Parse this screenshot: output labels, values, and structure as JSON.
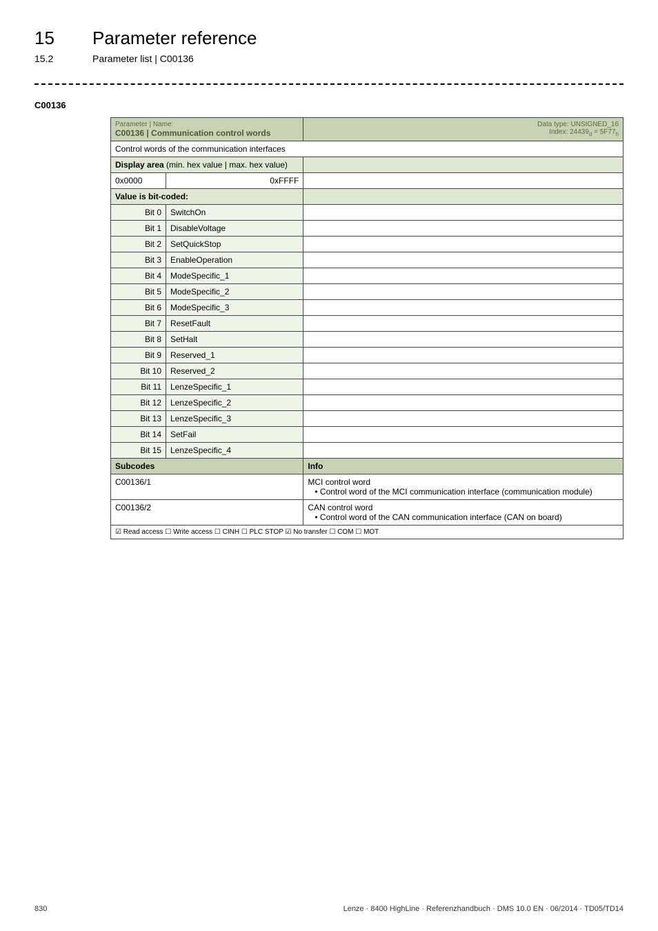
{
  "header": {
    "chapter_number": "15",
    "chapter_title": "Parameter reference",
    "section_number": "15.2",
    "section_title": "Parameter list | C00136"
  },
  "param_code_label": "C00136",
  "table": {
    "title_left_small": "Parameter | Name:",
    "title_left_bold": "C00136 | Communication control words",
    "title_right_line1": "Data type: UNSIGNED_16",
    "title_right_line2": "Index: 24439",
    "title_right_line2_sub1": "d",
    "title_right_line2_eq": " = 5F77",
    "title_right_line2_sub2": "h",
    "desc": "Control words of the communication interfaces",
    "display_area_label": "Display area",
    "display_area_paren": " (min. hex value | max. hex value)",
    "hex_min": "0x0000",
    "hex_max": "0xFFFF",
    "value_coded_label": "Value is bit-coded:",
    "bits": [
      {
        "label": "Bit 0",
        "name": "SwitchOn"
      },
      {
        "label": "Bit 1",
        "name": "DisableVoltage"
      },
      {
        "label": "Bit 2",
        "name": "SetQuickStop"
      },
      {
        "label": "Bit 3",
        "name": "EnableOperation"
      },
      {
        "label": "Bit 4",
        "name": "ModeSpecific_1"
      },
      {
        "label": "Bit 5",
        "name": "ModeSpecific_2"
      },
      {
        "label": "Bit 6",
        "name": "ModeSpecific_3"
      },
      {
        "label": "Bit 7",
        "name": "ResetFault"
      },
      {
        "label": "Bit 8",
        "name": "SetHalt"
      },
      {
        "label": "Bit 9",
        "name": "Reserved_1"
      },
      {
        "label": "Bit 10",
        "name": "Reserved_2"
      },
      {
        "label": "Bit 11",
        "name": "LenzeSpecific_1"
      },
      {
        "label": "Bit 12",
        "name": "LenzeSpecific_2"
      },
      {
        "label": "Bit 13",
        "name": "LenzeSpecific_3"
      },
      {
        "label": "Bit 14",
        "name": "SetFail"
      },
      {
        "label": "Bit 15",
        "name": "LenzeSpecific_4"
      }
    ],
    "subcodes_header_left": "Subcodes",
    "subcodes_header_right": "Info",
    "subcodes": [
      {
        "code": "C00136/1",
        "info_line1": "MCI control word",
        "info_line2": "Control word of the MCI communication interface (communication module)"
      },
      {
        "code": "C00136/2",
        "info_line1": "CAN control word",
        "info_line2": "Control word of the CAN communication interface (CAN on board)"
      }
    ],
    "access_line": "☑ Read access   ☐ Write access   ☐ CINH   ☐ PLC STOP   ☑ No transfer   ☐ COM   ☐ MOT"
  },
  "footer": {
    "page": "830",
    "right": "Lenze · 8400 HighLine · Referenzhandbuch · DMS 10.0 EN · 06/2014 · TD05/TD14"
  }
}
